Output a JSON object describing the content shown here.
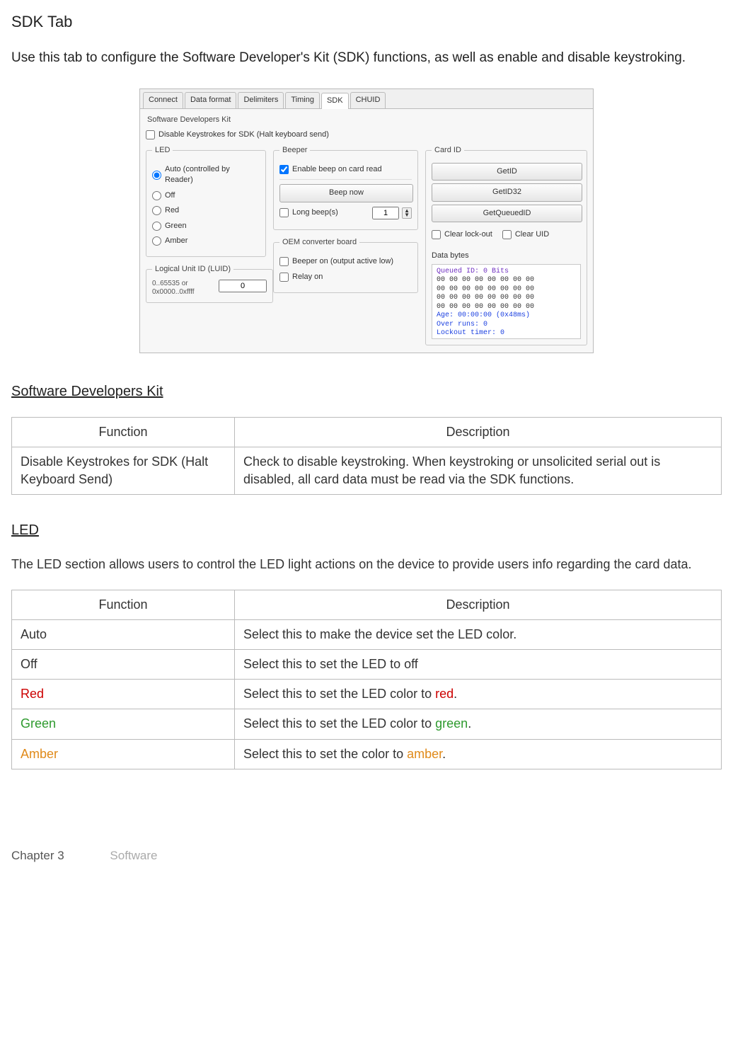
{
  "page": {
    "title": "SDK Tab",
    "intro": "Use this tab to configure the Software Developer's Kit (SDK) functions,  as well as enable and disable keystroking."
  },
  "tabs": [
    "Connect",
    "Data format",
    "Delimiters",
    "Timing",
    "SDK",
    "CHUID"
  ],
  "panel": {
    "title": "Software Developers Kit",
    "disable_keystrokes_label": "Disable Keystrokes for SDK (Halt keyboard send)",
    "led": {
      "legend": "LED",
      "auto": "Auto (controlled by Reader)",
      "off": "Off",
      "red": "Red",
      "green": "Green",
      "amber": "Amber",
      "luid_legend": "Logical Unit ID (LUID)",
      "luid_hint": "0..65535 or 0x0000..0xffff",
      "luid_value": "0"
    },
    "beeper": {
      "legend": "Beeper",
      "enable": "Enable beep on card read",
      "beep_now": "Beep now",
      "long_beeps": "Long beep(s)",
      "long_beeps_value": "1"
    },
    "oem": {
      "legend": "OEM converter board",
      "beeper_on": "Beeper on (output active low)",
      "relay_on": "Relay on"
    },
    "cardid": {
      "legend": "Card ID",
      "getid": "GetID",
      "getid32": "GetID32",
      "getqueued": "GetQueuedID",
      "clear_lockout": "Clear lock-out",
      "clear_uid": "Clear UID",
      "data_bytes_label": "Data bytes",
      "data_lines": {
        "l1": "Queued ID: 0 Bits",
        "l2": "00 00 00 00 00 00 00 00",
        "l3": "00 00 00 00 00 00 00 00",
        "l4": "00 00 00 00 00 00 00 00",
        "l5": "00 00 00 00 00 00 00 00",
        "l6": "Age: 00:00:00 (0x48ms)",
        "l7": "Over runs: 0",
        "l8": "Lockout timer: 0"
      }
    }
  },
  "sdk_table": {
    "heading": "Software Developers Kit",
    "head_function": "Function",
    "head_description": "Description",
    "row1_fn": "Disable Keystrokes for SDK (Halt Keyboard Send)",
    "row1_desc": "Check to disable keystroking. When keystroking or unsolicited serial out is disabled, all card data must be read via the SDK functions."
  },
  "led_section": {
    "heading": "LED",
    "intro": "The LED section  allows  users to control the LED light actions on the device to provide users info regarding the card data.",
    "head_function": "Function",
    "head_description": "Description",
    "rows": {
      "auto_fn": "Auto",
      "auto_desc": "Select this to make the device set the LED color.",
      "off_fn": "Off",
      "off_desc": "Select this to set the LED to off",
      "red_fn": "Red",
      "red_desc_pre": "Select this to set the LED color  to ",
      "red_desc_word": "red",
      "green_fn": "Green",
      "green_desc_pre": "Select this to set the LED color  to ",
      "green_desc_word": "green",
      "amber_fn": "Amber",
      "amber_desc_pre": "Select this to set the color to ",
      "amber_desc_word": "amber"
    }
  },
  "footer": {
    "chapter": "Chapter 3",
    "section": "Software"
  }
}
